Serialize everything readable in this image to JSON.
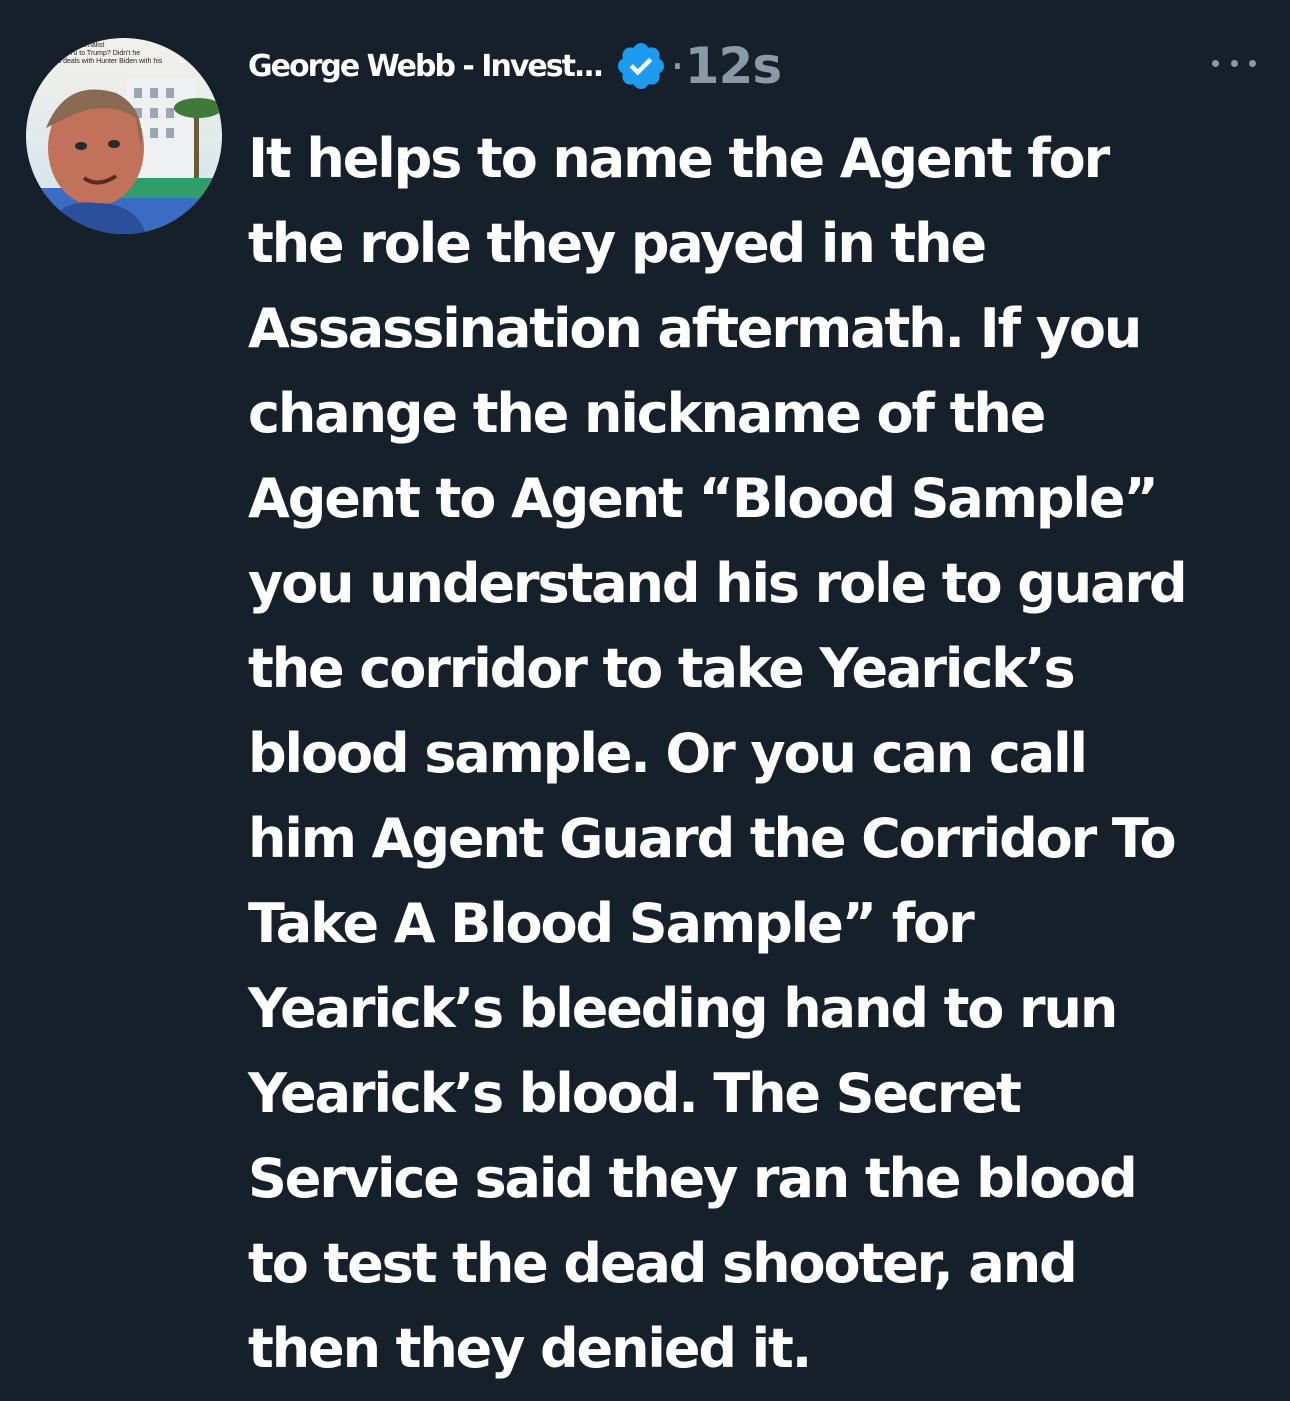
{
  "tweet": {
    "author": {
      "display_name": "George Webb - Invest...",
      "verified": true,
      "avatar_caption": [
        "...egative Journalist",
        "...me of Yu to Trump?  Didn't he",
        "...ons deals with Hunter Biden with his"
      ]
    },
    "separator": "·",
    "timestamp": "12s",
    "body_lines": [
      "It helps to name the Agent for",
      "the role they payed in the",
      "Assassination aftermath. If you",
      "change the nickname of the",
      "Agent to Agent “Blood Sample”",
      "you understand his role to guard",
      "the corridor to take Yearick’s",
      "blood sample. Or you can call",
      "him Agent Guard the Corridor To",
      "Take A Blood Sample” for",
      "Yearick’s bleeding hand to run",
      "Yearick’s blood. The Secret",
      "Service said they ran the blood",
      "to test the dead shooter, and",
      "then they denied it."
    ]
  },
  "colors": {
    "background": "#15202b",
    "text_primary": "#ffffff",
    "text_secondary": "#8b98a5",
    "verified_badge": "#1d9bf0"
  },
  "icons": {
    "verified": "verified-badge-icon",
    "more": "more-options-icon"
  }
}
